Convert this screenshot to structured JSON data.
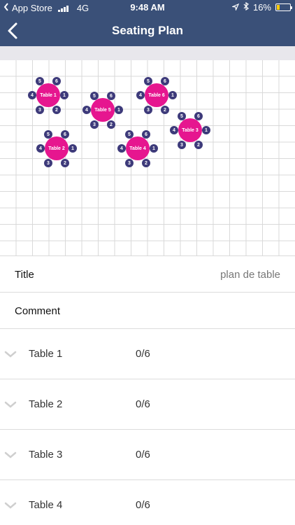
{
  "status_bar": {
    "back_app": "App Store",
    "network": "4G",
    "time": "9:48 AM",
    "battery": "16%"
  },
  "nav": {
    "title": "Seating Plan"
  },
  "plan": {
    "tables": [
      {
        "label": "Table 1"
      },
      {
        "label": "Table 5"
      },
      {
        "label": "Table 6"
      },
      {
        "label": "Table 3"
      },
      {
        "label": "Table 2"
      },
      {
        "label": "Table 4"
      }
    ],
    "seat_numbers": [
      "1",
      "2",
      "3",
      "4",
      "5",
      "6"
    ]
  },
  "form": {
    "title_label": "Title",
    "title_value": "plan de table",
    "comment_label": "Comment"
  },
  "table_list": [
    {
      "name": "Table 1",
      "occupancy": "0/6"
    },
    {
      "name": "Table 2",
      "occupancy": "0/6"
    },
    {
      "name": "Table 3",
      "occupancy": "0/6"
    },
    {
      "name": "Table 4",
      "occupancy": "0/6"
    }
  ],
  "colors": {
    "header": "#3a5078",
    "table": "#e6168f",
    "seat": "#3d3a7a"
  }
}
